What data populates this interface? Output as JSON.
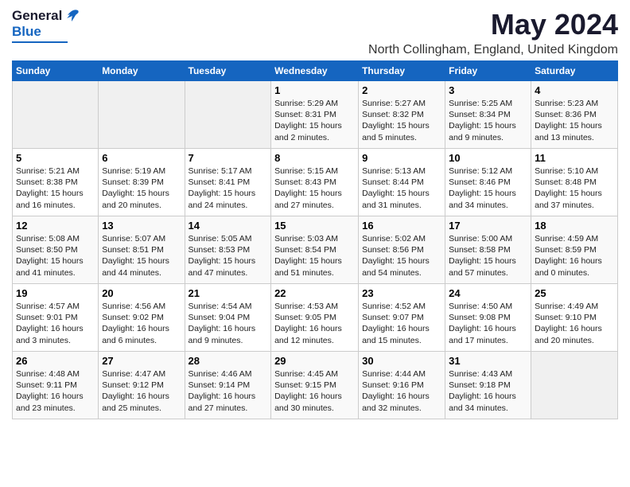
{
  "logo": {
    "general": "General",
    "blue": "Blue"
  },
  "title": "May 2024",
  "location": "North Collingham, England, United Kingdom",
  "headers": [
    "Sunday",
    "Monday",
    "Tuesday",
    "Wednesday",
    "Thursday",
    "Friday",
    "Saturday"
  ],
  "weeks": [
    [
      {
        "day": "",
        "info": ""
      },
      {
        "day": "",
        "info": ""
      },
      {
        "day": "",
        "info": ""
      },
      {
        "day": "1",
        "info": "Sunrise: 5:29 AM\nSunset: 8:31 PM\nDaylight: 15 hours\nand 2 minutes."
      },
      {
        "day": "2",
        "info": "Sunrise: 5:27 AM\nSunset: 8:32 PM\nDaylight: 15 hours\nand 5 minutes."
      },
      {
        "day": "3",
        "info": "Sunrise: 5:25 AM\nSunset: 8:34 PM\nDaylight: 15 hours\nand 9 minutes."
      },
      {
        "day": "4",
        "info": "Sunrise: 5:23 AM\nSunset: 8:36 PM\nDaylight: 15 hours\nand 13 minutes."
      }
    ],
    [
      {
        "day": "5",
        "info": "Sunrise: 5:21 AM\nSunset: 8:38 PM\nDaylight: 15 hours\nand 16 minutes."
      },
      {
        "day": "6",
        "info": "Sunrise: 5:19 AM\nSunset: 8:39 PM\nDaylight: 15 hours\nand 20 minutes."
      },
      {
        "day": "7",
        "info": "Sunrise: 5:17 AM\nSunset: 8:41 PM\nDaylight: 15 hours\nand 24 minutes."
      },
      {
        "day": "8",
        "info": "Sunrise: 5:15 AM\nSunset: 8:43 PM\nDaylight: 15 hours\nand 27 minutes."
      },
      {
        "day": "9",
        "info": "Sunrise: 5:13 AM\nSunset: 8:44 PM\nDaylight: 15 hours\nand 31 minutes."
      },
      {
        "day": "10",
        "info": "Sunrise: 5:12 AM\nSunset: 8:46 PM\nDaylight: 15 hours\nand 34 minutes."
      },
      {
        "day": "11",
        "info": "Sunrise: 5:10 AM\nSunset: 8:48 PM\nDaylight: 15 hours\nand 37 minutes."
      }
    ],
    [
      {
        "day": "12",
        "info": "Sunrise: 5:08 AM\nSunset: 8:50 PM\nDaylight: 15 hours\nand 41 minutes."
      },
      {
        "day": "13",
        "info": "Sunrise: 5:07 AM\nSunset: 8:51 PM\nDaylight: 15 hours\nand 44 minutes."
      },
      {
        "day": "14",
        "info": "Sunrise: 5:05 AM\nSunset: 8:53 PM\nDaylight: 15 hours\nand 47 minutes."
      },
      {
        "day": "15",
        "info": "Sunrise: 5:03 AM\nSunset: 8:54 PM\nDaylight: 15 hours\nand 51 minutes."
      },
      {
        "day": "16",
        "info": "Sunrise: 5:02 AM\nSunset: 8:56 PM\nDaylight: 15 hours\nand 54 minutes."
      },
      {
        "day": "17",
        "info": "Sunrise: 5:00 AM\nSunset: 8:58 PM\nDaylight: 15 hours\nand 57 minutes."
      },
      {
        "day": "18",
        "info": "Sunrise: 4:59 AM\nSunset: 8:59 PM\nDaylight: 16 hours\nand 0 minutes."
      }
    ],
    [
      {
        "day": "19",
        "info": "Sunrise: 4:57 AM\nSunset: 9:01 PM\nDaylight: 16 hours\nand 3 minutes."
      },
      {
        "day": "20",
        "info": "Sunrise: 4:56 AM\nSunset: 9:02 PM\nDaylight: 16 hours\nand 6 minutes."
      },
      {
        "day": "21",
        "info": "Sunrise: 4:54 AM\nSunset: 9:04 PM\nDaylight: 16 hours\nand 9 minutes."
      },
      {
        "day": "22",
        "info": "Sunrise: 4:53 AM\nSunset: 9:05 PM\nDaylight: 16 hours\nand 12 minutes."
      },
      {
        "day": "23",
        "info": "Sunrise: 4:52 AM\nSunset: 9:07 PM\nDaylight: 16 hours\nand 15 minutes."
      },
      {
        "day": "24",
        "info": "Sunrise: 4:50 AM\nSunset: 9:08 PM\nDaylight: 16 hours\nand 17 minutes."
      },
      {
        "day": "25",
        "info": "Sunrise: 4:49 AM\nSunset: 9:10 PM\nDaylight: 16 hours\nand 20 minutes."
      }
    ],
    [
      {
        "day": "26",
        "info": "Sunrise: 4:48 AM\nSunset: 9:11 PM\nDaylight: 16 hours\nand 23 minutes."
      },
      {
        "day": "27",
        "info": "Sunrise: 4:47 AM\nSunset: 9:12 PM\nDaylight: 16 hours\nand 25 minutes."
      },
      {
        "day": "28",
        "info": "Sunrise: 4:46 AM\nSunset: 9:14 PM\nDaylight: 16 hours\nand 27 minutes."
      },
      {
        "day": "29",
        "info": "Sunrise: 4:45 AM\nSunset: 9:15 PM\nDaylight: 16 hours\nand 30 minutes."
      },
      {
        "day": "30",
        "info": "Sunrise: 4:44 AM\nSunset: 9:16 PM\nDaylight: 16 hours\nand 32 minutes."
      },
      {
        "day": "31",
        "info": "Sunrise: 4:43 AM\nSunset: 9:18 PM\nDaylight: 16 hours\nand 34 minutes."
      },
      {
        "day": "",
        "info": ""
      }
    ]
  ]
}
